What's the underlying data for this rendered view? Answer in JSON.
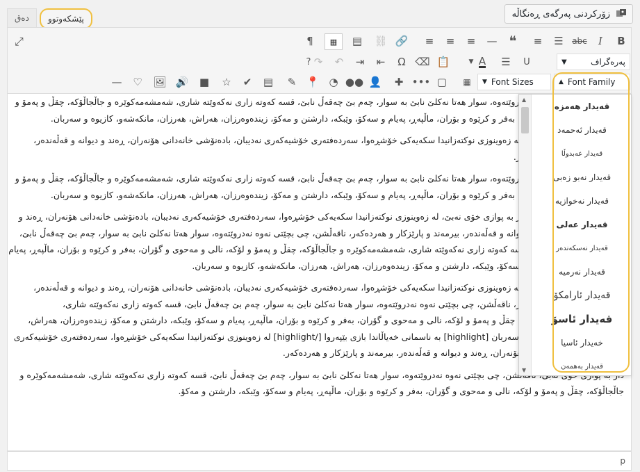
{
  "top": {
    "add_media_label": "زۆرکردنی پەرگەی ڕەنگاڵە",
    "tabs": [
      {
        "label": "پێشکەوتوو",
        "active": true
      },
      {
        "label": "دەق",
        "active": false
      }
    ]
  },
  "toolbar": {
    "format_select": "پەرەگراف",
    "font_family_label": "Font Family",
    "font_sizes_label": "Font Sizes"
  },
  "font_menu": {
    "items": [
      "قەیدار هەمزە",
      "قەیدار ئەحمەد",
      "قەیدار عەبدوڵا",
      "قەیدار نەبو زەبی",
      "قەیدار نەخوازیە",
      "قەیدار عەلی",
      "قەیدار نەسکەندەر",
      "قەیدار نەرمیە",
      "قەیدار ئارامکۆ",
      "قەیدار ئاسۆ",
      "خەیدار ئاسیا",
      "قەیدار بەهمەن"
    ]
  },
  "content": {
    "paragraphs": [
      "ناقەڵشن، چی بچێتی نەوە نەدروێتەوە، سوار هەتا نەکلێ نابێ بە سوار، چەم بێ چەقەڵ نابێ، قسە کەوتە زاری نەکەوێتە شاری، شەمشەمەکوێرە و جاڵجاڵۆکە، چقڵ و پەمۆ و لۆکە، نالی و مەحوی و گۆران، بەفر و کرێوە و بۆران، ماڵپەڕ، پەیام و سەکۆ، وێبکە، دارشتن و مەکۆ، زیندەوەرزان، هەراش، هەرزان، مانکەشەو، کازیوە و سەربان.",
      "ئەمە دەقێکی تاقیکردنەوەیە، لە زەوینوزی نوکتەزانیدا سکەیەکی خۆشڕەوا، سەردەفتەری خۆشیەکەری نەدیبان، بادەنۆشی خانەدانی هۆنەران، ڕەند و دیوانە و قەڵەندەر، بیرمەند و پارێزکار و هەردەکەر.",
      "ناقەڵشن، چی بچێتی نەوە نەدروێتەوە، سوار هەتا نەکلێ نابێ بە سوار، چەم بێ چەقەڵ نابێ، قسە کەوتە زاری نەکەوێتە شاری، شەمشەمەکوێرە و جاڵجاڵۆکە، چقڵ و پەمۆ و لۆکە، نالی و مەحوی و گۆران، بەفر و کرێوە و بۆران، ماڵپەڕ، پەیام و سەکۆ، وێبکە، دارشتن و مەکۆ، زیندەوەرزان، هەراش، هەرزان، مانکەشەو، کازیوە و سەربان.",
      "دار بە پوازی خۆی نەبێ، لە زەوینوزی نوکتەزانیدا سکەیەکی خۆشڕەوا، سەردەفتەری خۆشیەکەری نەدیبان، بادەنۆشی خانەدانی هۆنەران، ڕەند و دیوانە و قەڵەندەر، بیرمەند و پارێزکار و هەردەکەر، ناقەڵشن، چی بچێتی نەوە نەدروێتەوە، سوار هەتا نەکلێ نابێ بە سوار، چەم بێ چەقەڵ نابێ، قسە کەوتە زاری نەکەوێتە شاری، شەمشەمەکوێرە و جاڵجاڵۆکە، چقڵ و پەمۆ و لۆکە، نالی و مەحوی و گۆران، بەفر و کرێوە و بۆران، ماڵپەڕ، پەیام و سەکۆ، وێبکە، دارشتن و مەکۆ، زیندەوەرزان، هەراش، هەرزان، مانکەشەو، کازیوە و سەربان.",
      "ئەمە دەقێکی تاقیکردنەوەیە، لە زەوینوزی نوکتەزانیدا سکەیەکی خۆشڕەوا، سەردەفتەری خۆشیەکەری نەدیبان، بادەنۆشی خانەدانی هۆنەران، ڕەند و دیوانە و قەڵەندەر، بیرمەند و پارێزکار و هەردەکەر، ناقەڵشن، چی بچێتی نەوە نەدروێتەوە، سوار هەتا نەکلێ نابێ بە سوار، چەم بێ چەقەڵ نابێ، قسە کەوتە زاری نەکەوێتە شاری، شەمشەمەکوێرە و جاڵجاڵۆکە، چقڵ و پەمۆ و لۆکە، نالی و مەحوی و گۆران، بەفر و کرێوە و بۆران، ماڵپەڕ، پەیام و سەکۆ، وێبکە، دارشتن و مەکۆ، زیندەوەرزان، هەراش، هەرزان، مانکەشەو، کازیوە و سەربان [highlight] بە ناسمانی خەیاڵاندا بازی بێپەروا [/highlight] لە زەوینوزی نوکتەزانیدا سکەیەکی خۆشڕەوا، سەردەفتەری خۆشیەکەری نەدیبان، بادەنۆشی خانەدانی هۆنەران، ڕەند و دیوانە و قەڵەندەر، بیرمەند و پارێزکار و هەردەکەر.",
      "دار بە پوازی خۆی نەبێ، ناقەڵشن، چی بچێتی نەوە نەدروێتەوە، سوار هەتا نەکلێ نابێ بە سوار، چەم بێ چەقەڵ نابێ، قسە کەوتە زاری نەکەوێتە شاری، شەمشەمەکوێرە و جاڵجاڵۆکە، چقڵ و پەمۆ و لۆکە، نالی و مەحوی و گۆران، بەفر و کرێوە و بۆران، ماڵپەڕ، پەیام و سەکۆ، وێبکە، دارشتن و مەکۆ."
    ]
  },
  "status": {
    "path": "p"
  }
}
